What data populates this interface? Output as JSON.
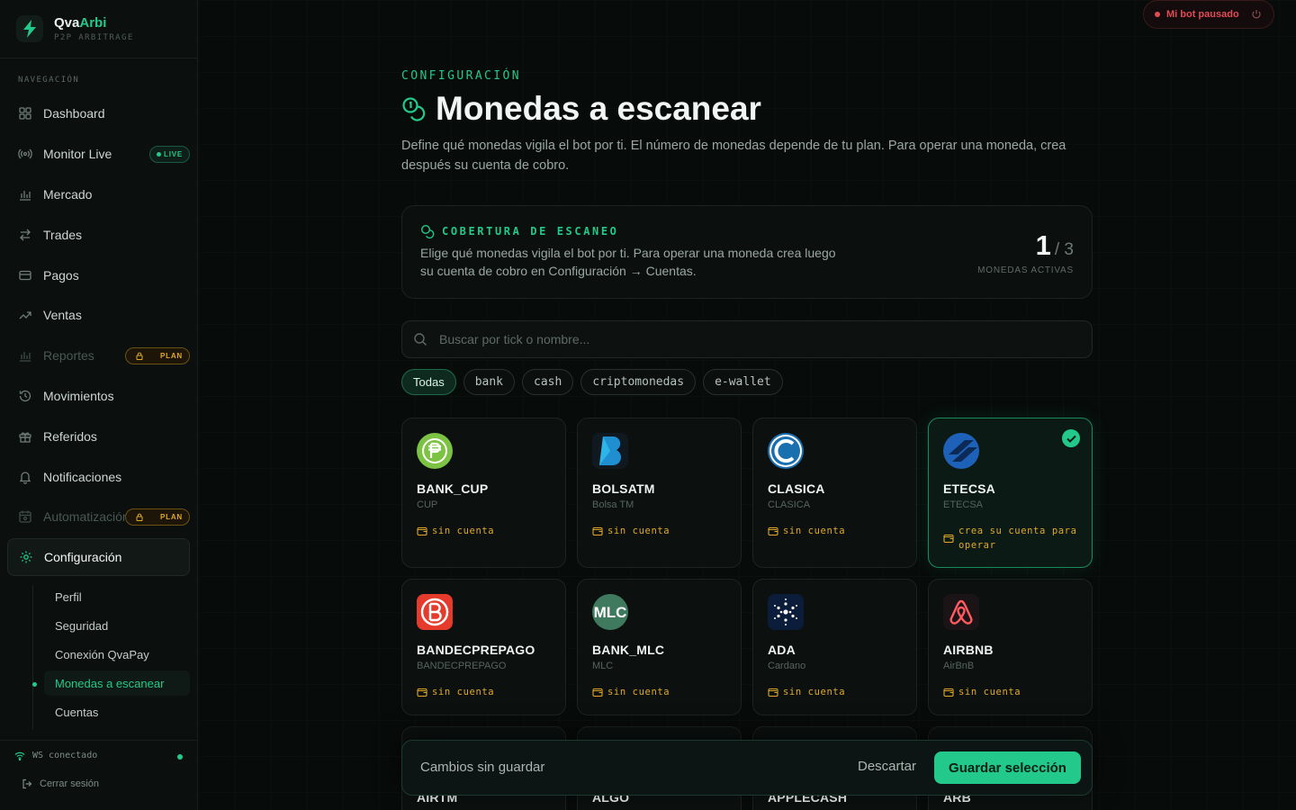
{
  "brand": {
    "name_a": "Qva",
    "name_b": "Arbi",
    "subtitle": "P2P ARBITRAGE"
  },
  "sidebar": {
    "section_title": "NAVEGACIÓN",
    "items": [
      {
        "label": "Dashboard",
        "icon": "grid-icon"
      },
      {
        "label": "Monitor Live",
        "icon": "radio-icon",
        "badge": "LIVE"
      },
      {
        "label": "Mercado",
        "icon": "bar-chart-icon"
      },
      {
        "label": "Trades",
        "icon": "swap-icon"
      },
      {
        "label": "Pagos",
        "icon": "credit-card-icon"
      },
      {
        "label": "Ventas",
        "icon": "trend-up-icon"
      },
      {
        "label": "Reportes",
        "icon": "bar-chart-icon",
        "badge": "PLAN",
        "disabled": true
      },
      {
        "label": "Movimientos",
        "icon": "history-icon"
      },
      {
        "label": "Referidos",
        "icon": "gift-icon"
      },
      {
        "label": "Notificaciones",
        "icon": "bell-icon"
      },
      {
        "label": "Automatización",
        "icon": "calendar-icon",
        "badge": "PLAN",
        "disabled": true
      },
      {
        "label": "Configuración",
        "icon": "gear-icon",
        "active": true
      }
    ],
    "sub_items": [
      {
        "label": "Perfil"
      },
      {
        "label": "Seguridad"
      },
      {
        "label": "Conexión QvaPay"
      },
      {
        "label": "Monedas a escanear",
        "active": true
      },
      {
        "label": "Cuentas"
      }
    ],
    "ws_status": "WS conectado",
    "logout": "Cerrar sesión"
  },
  "topbar": {
    "bot_status": "Mi bot pausado"
  },
  "page": {
    "eyebrow": "CONFIGURACIÓN",
    "title": "Monedas a escanear",
    "description": "Define qué monedas vigila el bot por ti. El número de monedas depende de tu plan. Para operar una moneda, crea después su cuenta de cobro."
  },
  "coverage": {
    "title": "COBERTURA DE ESCANEO",
    "text": "Elige qué monedas vigila el bot por ti. Para operar una moneda crea luego su cuenta de cobro en Configuración → Cuentas.",
    "active": "1",
    "total": "/ 3",
    "label": "MONEDAS ACTIVAS"
  },
  "search": {
    "placeholder": "Buscar por tick o nombre..."
  },
  "filters": [
    {
      "label": "Todas",
      "active": true
    },
    {
      "label": "bank"
    },
    {
      "label": "cash"
    },
    {
      "label": "criptomonedas"
    },
    {
      "label": "e-wallet"
    }
  ],
  "coins": [
    {
      "tick": "BANK_CUP",
      "name": "CUP",
      "account": "sin cuenta",
      "logo": "peso-coin-icon",
      "color": "#7cc243"
    },
    {
      "tick": "BOLSATM",
      "name": "Bolsa TM",
      "account": "sin cuenta",
      "logo": "bolsatm-icon",
      "color": "#1f8fd1"
    },
    {
      "tick": "CLASICA",
      "name": "CLASICA",
      "account": "sin cuenta",
      "logo": "clasica-icon",
      "color": "#1a6fae"
    },
    {
      "tick": "ETECSA",
      "name": "ETECSA",
      "account": "crea su cuenta para operar",
      "logo": "etecsa-icon",
      "color": "#1d62b8",
      "selected": true
    },
    {
      "tick": "BANDECPREPAGO",
      "name": "BANDECPREPAGO",
      "account": "sin cuenta",
      "logo": "bandec-icon",
      "color": "#e53b2c"
    },
    {
      "tick": "BANK_MLC",
      "name": "MLC",
      "account": "sin cuenta",
      "logo": "mlc-icon",
      "color": "#3f7a5e"
    },
    {
      "tick": "ADA",
      "name": "Cardano",
      "account": "sin cuenta",
      "logo": "cardano-icon",
      "color": "#0b1d3a"
    },
    {
      "tick": "AIRBNB",
      "name": "AirBnB",
      "account": "sin cuenta",
      "logo": "airbnb-icon",
      "color": "#ff5a5f"
    },
    {
      "tick": "AIRTM",
      "name": "",
      "account": "",
      "logo": "",
      "color": ""
    },
    {
      "tick": "ALGO",
      "name": "",
      "account": "",
      "logo": "",
      "color": ""
    },
    {
      "tick": "APPLECASH",
      "name": "",
      "account": "",
      "logo": "",
      "color": ""
    },
    {
      "tick": "ARB",
      "name": "",
      "account": "",
      "logo": "",
      "color": ""
    }
  ],
  "savebar": {
    "text": "Cambios sin guardar",
    "discard": "Descartar",
    "save": "Guardar selección"
  },
  "colors": {
    "accent": "#22c98a",
    "warning": "#e0a92a",
    "danger": "#e24b55"
  }
}
